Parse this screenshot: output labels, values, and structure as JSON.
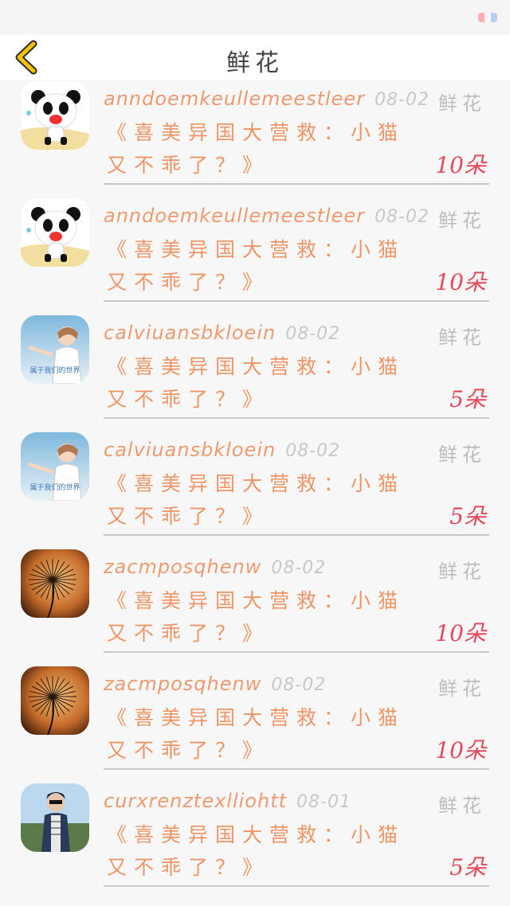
{
  "nav": {
    "title": "鲜花"
  },
  "items": [
    {
      "user": "anndoemkeullemeestleer",
      "date": "08-02",
      "label": "鲜花",
      "text": "《喜美异国大营救：小猫又不乖了？》",
      "count": "10朵",
      "avatar": "panda"
    },
    {
      "user": "anndoemkeullemeestleer",
      "date": "08-02",
      "label": "鲜花",
      "text": "《喜美异国大营救：小猫又不乖了？》",
      "count": "10朵",
      "avatar": "panda"
    },
    {
      "user": "calviuansbkloein",
      "date": "08-02",
      "label": "鲜花",
      "text": "《喜美异国大营救：小猫又不乖了？》",
      "count": "5朵",
      "avatar": "girl",
      "avatar_text": "属于我们的世界"
    },
    {
      "user": "calviuansbkloein",
      "date": "08-02",
      "label": "鲜花",
      "text": "《喜美异国大营救：小猫又不乖了？》",
      "count": "5朵",
      "avatar": "girl",
      "avatar_text": "属于我们的世界"
    },
    {
      "user": "zacmposqhenw",
      "date": "08-02",
      "label": "鲜花",
      "text": "《喜美异国大营救：小猫又不乖了？》",
      "count": "10朵",
      "avatar": "dandelion"
    },
    {
      "user": "zacmposqhenw",
      "date": "08-02",
      "label": "鲜花",
      "text": "《喜美异国大营救：小猫又不乖了？》",
      "count": "10朵",
      "avatar": "dandelion"
    },
    {
      "user": "curxrenztexlliohtt",
      "date": "08-01",
      "label": "鲜花",
      "text": "《喜美异国大营救：小猫又不乖了？》",
      "count": "5朵",
      "avatar": "man"
    }
  ],
  "colors": {
    "username": "#ee9a70",
    "content": "#ee9566",
    "count": "#e44a5a",
    "label": "#bdbdbd",
    "back_icon": "#f2c200"
  }
}
